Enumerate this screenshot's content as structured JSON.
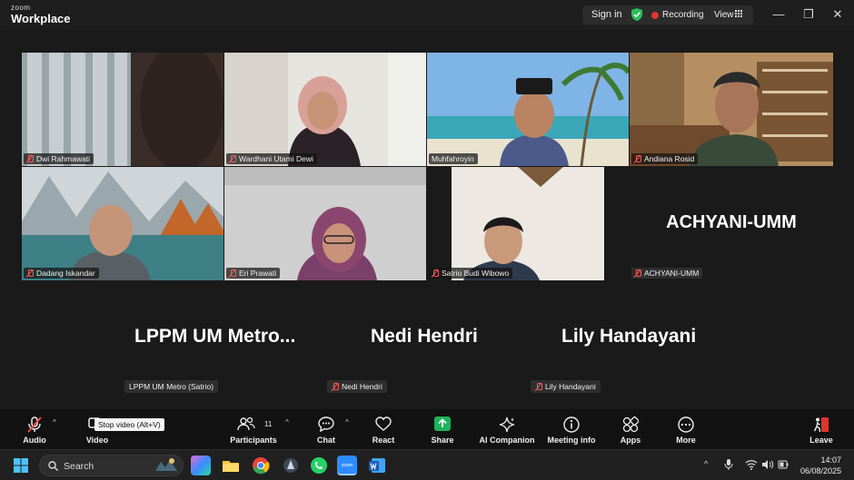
{
  "titlebar": {
    "brand_top": "zoom",
    "brand_main": "Workplace",
    "sign_in": "Sign in",
    "recording": "Recording",
    "view": "View"
  },
  "tiles": [
    {
      "name": "Dwi Rahmawati",
      "muted": true
    },
    {
      "name": "Wardhani Utami Dewi",
      "muted": true
    },
    {
      "name": "Muhfahroyin",
      "muted": false
    },
    {
      "name": "Andiana Rosid",
      "muted": true,
      "active_speaker": true
    },
    {
      "name": "Dadang Iskandar",
      "muted": true
    },
    {
      "name": "Eri Prawati",
      "muted": true
    },
    {
      "name": "Satrio Budi Wibowo",
      "muted": true
    },
    {
      "name": "ACHYANI-UMM",
      "muted": true,
      "video_off": true,
      "display_name": "ACHYANI-UMM"
    }
  ],
  "video_off_participants": [
    {
      "display_name": "LPPM UM Metro...",
      "tag": "LPPM UM Metro (Satrio)",
      "muted": false
    },
    {
      "display_name": "Nedi Hendri",
      "tag": "Nedi Hendri",
      "muted": true
    },
    {
      "display_name": "Lily Handayani",
      "tag": "Lily Handayani",
      "muted": true
    }
  ],
  "toolbar": {
    "audio": "Audio",
    "video": "Video",
    "video_tooltip": "Stop video (Alt+V)",
    "participants": "Participants",
    "participants_count": "11",
    "chat": "Chat",
    "react": "React",
    "share": "Share",
    "ai_companion": "AI Companion",
    "meeting_info": "Meeting info",
    "apps": "Apps",
    "more": "More",
    "leave": "Leave"
  },
  "taskbar": {
    "search": "Search",
    "time": "14:07",
    "date": "06/08/2025"
  },
  "colors": {
    "active_speaker": "#24c45a",
    "muted_icon": "#ff5a55",
    "share_green": "#1fb35b",
    "leave_red": "#e0352b"
  }
}
